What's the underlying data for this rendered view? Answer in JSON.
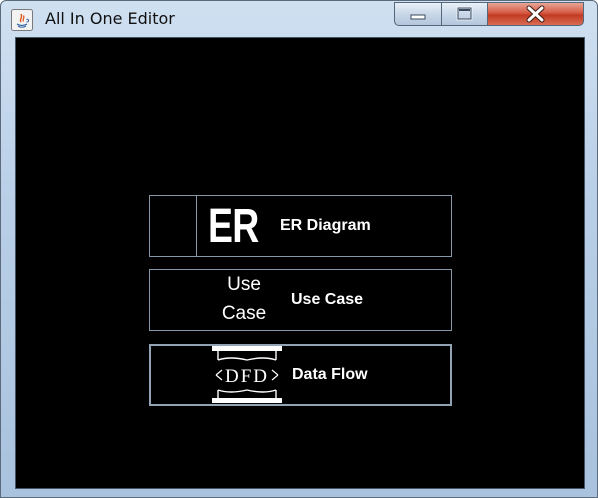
{
  "window": {
    "title": "All In One Editor",
    "controls": {
      "minimize_icon": "minimize-icon",
      "maximize_icon": "maximize-icon",
      "close_icon": "close-icon"
    }
  },
  "menu": {
    "items": [
      {
        "id": "er",
        "icon_text": "ER",
        "label": "ER Diagram"
      },
      {
        "id": "usecase",
        "icon_lines": [
          "Use",
          "Case"
        ],
        "label": "Use Case"
      },
      {
        "id": "dataflow",
        "icon_text": "DFD",
        "label": "Data Flow"
      }
    ]
  },
  "colors": {
    "client_background": "#000000",
    "button_border": "#8797a8",
    "button_text": "#ffffff",
    "close_button": "#c23a23"
  }
}
